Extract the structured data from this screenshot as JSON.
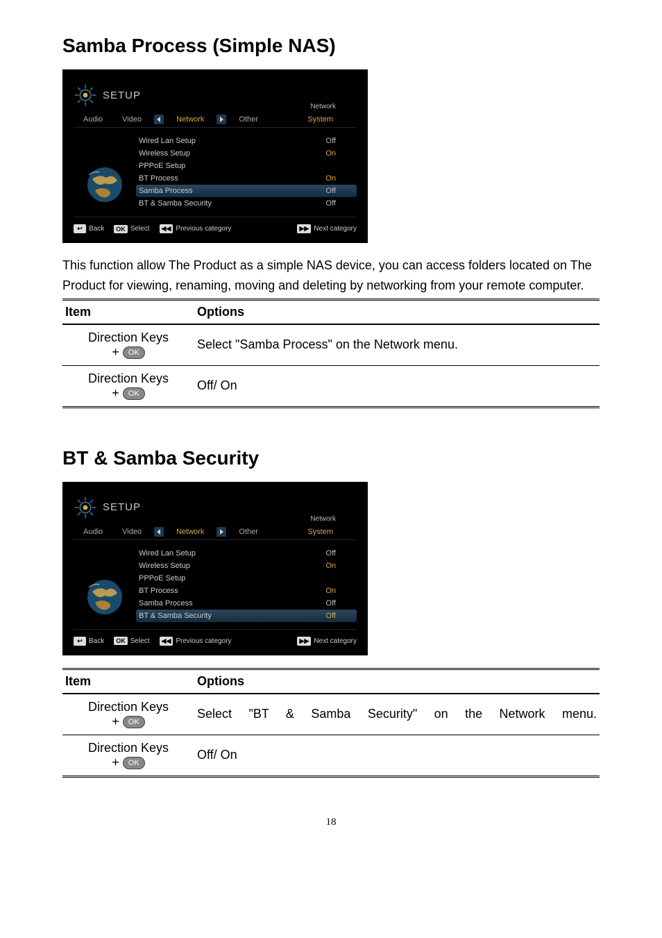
{
  "section1": {
    "heading": "Samba Process (Simple NAS)",
    "description": "This function allow The Product as a simple NAS device, you can access folders located on The Product for viewing, renaming, moving and deleting by networking from your remote computer.",
    "screenshot": {
      "setup_label": "SETUP",
      "net_label": "Network",
      "tabs": {
        "audio": "Audio",
        "video": "Video",
        "network": "Network",
        "other": "Other",
        "system": "System"
      },
      "rows": [
        {
          "label": "Wired Lan Setup",
          "value": "Off"
        },
        {
          "label": "Wireless Setup",
          "value": "On"
        },
        {
          "label": "PPPoE Setup",
          "value": ""
        },
        {
          "label": "BT Process",
          "value": "On"
        },
        {
          "label": "Samba Process",
          "value": "Off"
        },
        {
          "label": "BT & Samba Security",
          "value": "Off"
        }
      ],
      "selected_index": 4,
      "hints": {
        "back": "Back",
        "select": "Select",
        "prev": "Previous category",
        "next": "Next category",
        "ok": "OK"
      }
    },
    "table": {
      "headers": {
        "item": "Item",
        "options": "Options"
      },
      "rows": [
        {
          "item": "Direction Keys",
          "ok": "OK",
          "option": "Select \"Samba Process\" on the Network menu."
        },
        {
          "item": "Direction Keys",
          "ok": "OK",
          "option": "Off/ On"
        }
      ]
    }
  },
  "section2": {
    "heading": "BT & Samba Security",
    "screenshot": {
      "setup_label": "SETUP",
      "net_label": "Network",
      "tabs": {
        "audio": "Audio",
        "video": "Video",
        "network": "Network",
        "other": "Other",
        "system": "System"
      },
      "rows": [
        {
          "label": "Wired Lan Setup",
          "value": "Off"
        },
        {
          "label": "Wireless Setup",
          "value": "On"
        },
        {
          "label": "PPPoE Setup",
          "value": ""
        },
        {
          "label": "BT Process",
          "value": "On"
        },
        {
          "label": "Samba Process",
          "value": "Off"
        },
        {
          "label": "BT & Samba Security",
          "value": "Off"
        }
      ],
      "selected_index": 5,
      "hints": {
        "back": "Back",
        "select": "Select",
        "prev": "Previous category",
        "next": "Next category",
        "ok": "OK"
      }
    },
    "table": {
      "headers": {
        "item": "Item",
        "options": "Options"
      },
      "rows": [
        {
          "item": "Direction Keys",
          "ok": "OK",
          "option": "Select \"BT & Samba Security\" on the Network menu.",
          "justify": true
        },
        {
          "item": "Direction Keys",
          "ok": "OK",
          "option": "Off/ On"
        }
      ]
    }
  },
  "page_number": "18"
}
